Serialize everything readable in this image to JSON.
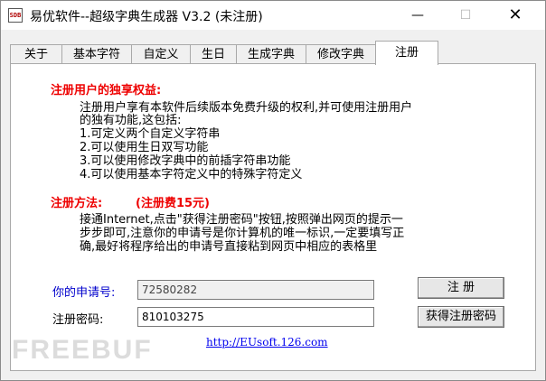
{
  "window": {
    "icon_text": "SDB",
    "title": "易优软件--超级字典生成器 V3.2 (未注册)",
    "minimize_glyph": "—",
    "maximize_glyph": "☐",
    "close_glyph": "✕"
  },
  "tabs": [
    {
      "label": "关于"
    },
    {
      "label": "基本字符"
    },
    {
      "label": "自定义"
    },
    {
      "label": "生日"
    },
    {
      "label": "生成字典"
    },
    {
      "label": "修改字典"
    },
    {
      "label": "注册"
    }
  ],
  "active_tab": "注册",
  "benefits": {
    "heading": "注册用户的独享权益:",
    "lines": [
      "注册用户享有本软件后续版本免费升级的权利,并可使用注册用户",
      "的独有功能,这包括:",
      "1.可定义两个自定义字符串",
      "2.可以使用生日双写功能",
      "3.可以使用修改字典中的前插字符串功能",
      "4.可以使用基本字符定义中的特殊字符定义"
    ]
  },
  "method": {
    "heading": "注册方法:",
    "fee": "(注册费15元)",
    "lines": [
      "接通Internet,点击\"获得注册密码\"按钮,按照弹出网页的提示一",
      "步步即可,注意你的申请号是你计算机的唯一标识,一定要填写正",
      "确,最好将程序给出的申请号直接粘到网页中相应的表格里"
    ]
  },
  "form": {
    "apply_label": "你的申请号:",
    "apply_value": "72580282",
    "password_label": "注册密码:",
    "password_value": "810103275",
    "register_button": "注  册",
    "get_password_button": "获得注册密码"
  },
  "link": "http://EUsoft.126.com",
  "watermark": "FREEBUF"
}
